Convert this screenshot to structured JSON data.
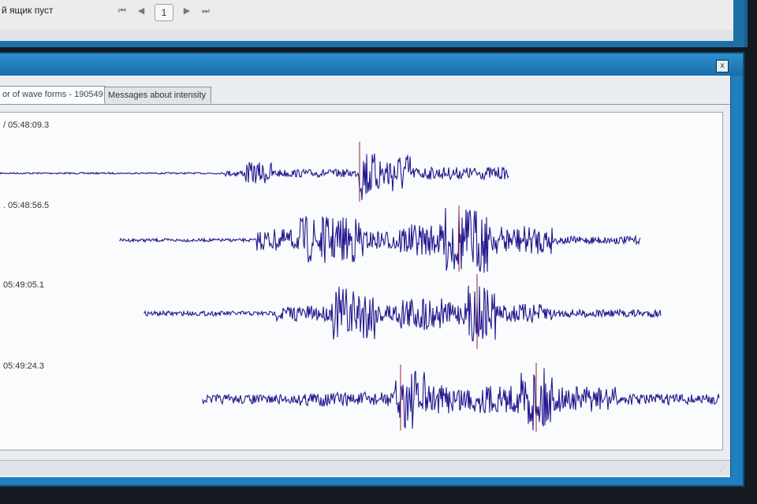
{
  "top_window": {
    "status_text": "й ящик пуст",
    "pager": {
      "first_icon": "first-page-icon",
      "prev_icon": "prev-page-icon",
      "page_number": "1",
      "next_icon": "next-page-icon",
      "last_icon": "last-page-icon"
    }
  },
  "window": {
    "close_label": "x",
    "tabs": [
      {
        "label": "or of wave forms - 190549",
        "active": true
      },
      {
        "label": "Messages about intensity",
        "active": false
      }
    ]
  },
  "traces": [
    {
      "time": "/ 05:48:09.3",
      "color": "#1f1a8c"
    },
    {
      "time": ". 05:48:56.5",
      "color": "#1f1a8c"
    },
    {
      "time": " 05:49:05.1",
      "color": "#1f1a8c"
    },
    {
      "time": " 05:49:24.3",
      "color": "#1f1a8c"
    }
  ],
  "colors": {
    "waveform": "#22198f",
    "waveform_spike": "#9a1f3a",
    "title_bar": "#1f7fbf"
  }
}
